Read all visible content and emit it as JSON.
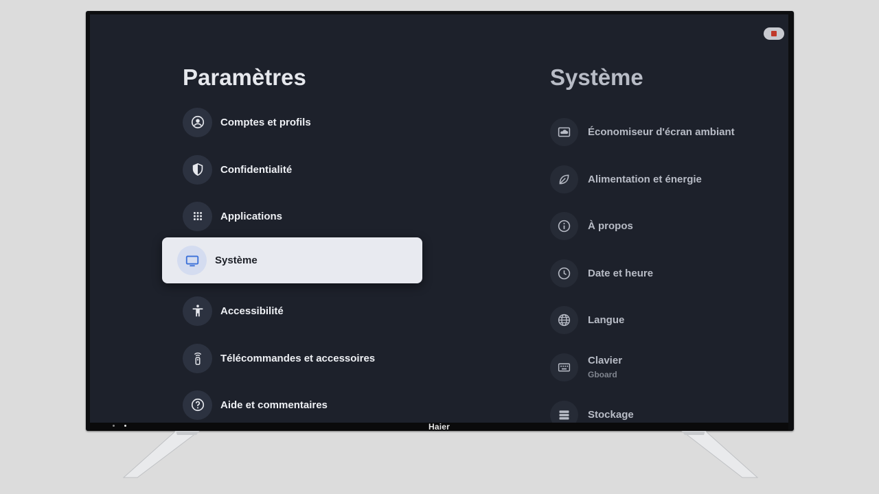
{
  "tv": {
    "brand": "Haier"
  },
  "left_panel": {
    "title": "Paramètres",
    "items": [
      {
        "label": "Comptes et profils",
        "icon": "account-circle-icon"
      },
      {
        "label": "Confidentialité",
        "icon": "shield-icon"
      },
      {
        "label": "Applications",
        "icon": "apps-grid-icon"
      },
      {
        "label": "Système",
        "icon": "tv-monitor-icon",
        "selected": true
      },
      {
        "label": "Accessibilité",
        "icon": "accessibility-icon"
      },
      {
        "label": "Télécommandes et accessoires",
        "icon": "remote-icon"
      },
      {
        "label": "Aide et commentaires",
        "icon": "help-icon"
      }
    ]
  },
  "right_panel": {
    "title": "Système",
    "items": [
      {
        "label": "Économiseur d'écran ambiant",
        "icon": "screensaver-icon"
      },
      {
        "label": "Alimentation et énergie",
        "icon": "leaf-icon"
      },
      {
        "label": "À propos",
        "icon": "info-icon"
      },
      {
        "label": "Date et heure",
        "icon": "clock-icon"
      },
      {
        "label": "Langue",
        "icon": "globe-icon"
      },
      {
        "label": "Clavier",
        "description": "Gboard",
        "icon": "keyboard-icon"
      },
      {
        "label": "Stockage",
        "icon": "storage-icon"
      }
    ]
  },
  "colors": {
    "screen_bg": "#1d212b",
    "icon_circle": "#2c3240",
    "selected_bg": "#e8eaf0",
    "accent_icon": "#3a6fd8"
  }
}
